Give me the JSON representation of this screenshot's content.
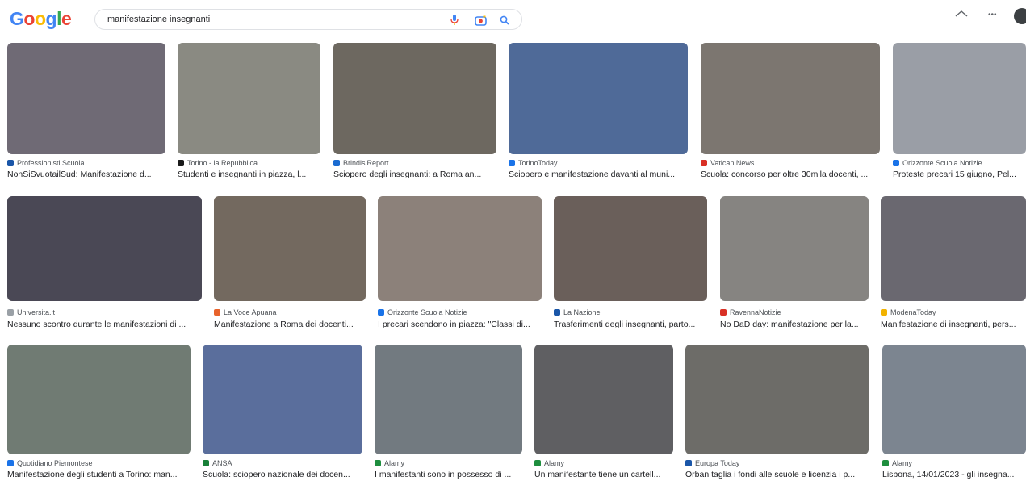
{
  "header": {
    "logo_letters": [
      {
        "ch": "G",
        "color": "#4285F4"
      },
      {
        "ch": "o",
        "color": "#EA4335"
      },
      {
        "ch": "o",
        "color": "#FBBC05"
      },
      {
        "ch": "g",
        "color": "#4285F4"
      },
      {
        "ch": "l",
        "color": "#34A853"
      },
      {
        "ch": "e",
        "color": "#EA4335"
      }
    ],
    "query": "manifestazione insegnanti",
    "more_label": "•••"
  },
  "rows": [
    {
      "cards": [
        {
          "thumb_color": "#6f6a75",
          "fav_color": "#1a56a8",
          "source": "Professionisti Scuola",
          "title": "NonSiSvuotailSud: Manifestazione d..."
        },
        {
          "thumb_color": "#8a8a82",
          "fav_color": "#1a1a1a",
          "source": "Torino - la Repubblica",
          "title": "Studenti e insegnanti in piazza, l..."
        },
        {
          "thumb_color": "#6d6860",
          "fav_color": "#1a6bd1",
          "source": "BrindisiReport",
          "title": "Sciopero degli insegnanti: a Roma an..."
        },
        {
          "thumb_color": "#4f6a98",
          "fav_color": "#1a73e8",
          "source": "TorinoToday",
          "title": "Sciopero e manifestazione davanti al muni..."
        },
        {
          "thumb_color": "#7c7670",
          "fav_color": "#d93025",
          "source": "Vatican News",
          "title": "Scuola: concorso per oltre 30mila docenti, ..."
        },
        {
          "thumb_color": "#9a9ea6",
          "fav_color": "#1a73e8",
          "source": "Orizzonte Scuola Notizie",
          "title": "Proteste precari 15 giugno, Pel..."
        }
      ]
    },
    {
      "cards": [
        {
          "thumb_color": "#4a4855",
          "fav_color": "#9aa0a6",
          "source": "Universita.it",
          "title": "Nessuno scontro durante le manifestazioni di ..."
        },
        {
          "thumb_color": "#73695f",
          "fav_color": "#e8632b",
          "source": "La Voce Apuana",
          "title": "Manifestazione a Roma dei docenti..."
        },
        {
          "thumb_color": "#8c817a",
          "fav_color": "#1a73e8",
          "source": "Orizzonte Scuola Notizie",
          "title": "I precari scendono in piazza: \"Classi di..."
        },
        {
          "thumb_color": "#6a5f5a",
          "fav_color": "#1a56a8",
          "source": "La Nazione",
          "title": "Trasferimenti degli insegnanti, parto..."
        },
        {
          "thumb_color": "#868481",
          "fav_color": "#d93025",
          "source": "RavennaNotizie",
          "title": "No DaD day: manifestazione per la..."
        },
        {
          "thumb_color": "#6a6870",
          "fav_color": "#f2b300",
          "source": "ModenaToday",
          "title": "Manifestazione di insegnanti, pers..."
        }
      ]
    },
    {
      "cards": [
        {
          "thumb_color": "#707b73",
          "fav_color": "#1a73e8",
          "source": "Quotidiano Piemontese",
          "title": "Manifestazione degli studenti a Torino: man..."
        },
        {
          "thumb_color": "#5a6e9c",
          "fav_color": "#188038",
          "source": "ANSA",
          "title": "Scuola: sciopero nazionale dei docen..."
        },
        {
          "thumb_color": "#727a80",
          "fav_color": "#1e8e3e",
          "source": "Alamy",
          "title": "I manifestanti sono in possesso di ..."
        },
        {
          "thumb_color": "#5f5f62",
          "fav_color": "#1e8e3e",
          "source": "Alamy",
          "title": "Un manifestante tiene un cartell..."
        },
        {
          "thumb_color": "#6d6c68",
          "fav_color": "#1a56a8",
          "source": "Europa Today",
          "title": "Orban taglia i fondi alle scuole e licenzia i p..."
        },
        {
          "thumb_color": "#7c8590",
          "fav_color": "#1e8e3e",
          "source": "Alamy",
          "title": "Lisbona, 14/01/2023 - gli insegna..."
        }
      ]
    }
  ]
}
